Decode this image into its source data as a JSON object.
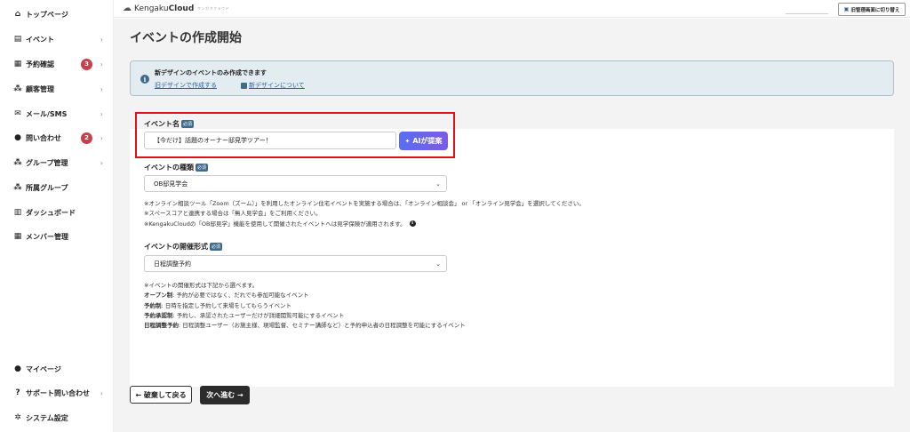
{
  "sidebar": {
    "items": [
      {
        "label": "トップページ",
        "icon": "home-icon",
        "glyph": "⌂"
      },
      {
        "label": "イベント",
        "icon": "document-icon",
        "glyph": "▤"
      },
      {
        "label": "予約確認",
        "icon": "calendar-icon",
        "glyph": "▦",
        "badge": "3"
      },
      {
        "label": "顧客管理",
        "icon": "users-icon",
        "glyph": "⁂"
      },
      {
        "label": "メール/SMS",
        "icon": "mail-icon",
        "glyph": "✉"
      },
      {
        "label": "問い合わせ",
        "icon": "chat-icon",
        "glyph": "●",
        "badge": "2"
      },
      {
        "label": "グループ管理",
        "icon": "group-icon",
        "glyph": "⁂"
      },
      {
        "label": "所属グループ",
        "icon": "group-member-icon",
        "glyph": "⁂"
      },
      {
        "label": "ダッシュボード",
        "icon": "chart-icon",
        "glyph": "▥"
      },
      {
        "label": "メンバー管理",
        "icon": "grid-icon",
        "glyph": "▦"
      }
    ],
    "bottom_items": [
      {
        "label": "マイページ",
        "icon": "person-icon",
        "glyph": "●"
      },
      {
        "label": "サポート問い合わせ",
        "icon": "help-icon",
        "glyph": "?"
      },
      {
        "label": "システム設定",
        "icon": "gear-icon",
        "glyph": "✲"
      }
    ],
    "chevron": "›"
  },
  "header": {
    "logo_text_light": "Kengaku",
    "logo_text_bold": "Cloud",
    "logo_tag": "ケンガククラウド",
    "switch_button": "旧管理画面に切り替え"
  },
  "main": {
    "title": "イベントの作成開始",
    "notice": {
      "title": "新デザインのイベントのみ作成できます",
      "link_old": "旧デザインで作成する",
      "link_new": "新デザインについて"
    },
    "required_badge": "必須",
    "event_name": {
      "label": "イベント名",
      "value": "【今だけ】話題のオーナー邸見学ツアー！",
      "ai_button": "AIが提案"
    },
    "event_type": {
      "label": "イベントの種類",
      "selected": "OB邸見学会",
      "help": [
        "※オンライン相談ツール「Zoom（ズーム）」を利用したオンライン住宅イベントを実施する場合は、「オンライン相談会」 or 「オンライン見学会」を選択してください。",
        "※スペースコアと連携する場合は「無人見学会」をご利用ください。",
        "※KengakuCloudの「OB邸見学」機能を使用して開催されたイベントへは見学保険が適用されます。"
      ]
    },
    "event_format": {
      "label": "イベントの開催形式",
      "selected": "日程調整予約",
      "help_intro": "※イベントの開催形式は下記から選べます。",
      "options": [
        {
          "name": "オープン制",
          "desc": ": 予約が必要ではなく、だれでも参加可能なイベント"
        },
        {
          "name": "予約制",
          "desc": ": 日時を指定し予約して来場をしてもらうイベント"
        },
        {
          "name": "予約承認制",
          "desc": ": 予約し、承認されたユーザーだけが詳細閲覧可能にするイベント"
        },
        {
          "name": "日程調整予約",
          "desc": ": 日程調整ユーザー（お施主様、現場監督、セミナー講師など）と予約申込者の日程調整を可能にするイベント"
        }
      ]
    },
    "back_button": "← 破棄して戻る",
    "next_button": "次へ進む →"
  }
}
